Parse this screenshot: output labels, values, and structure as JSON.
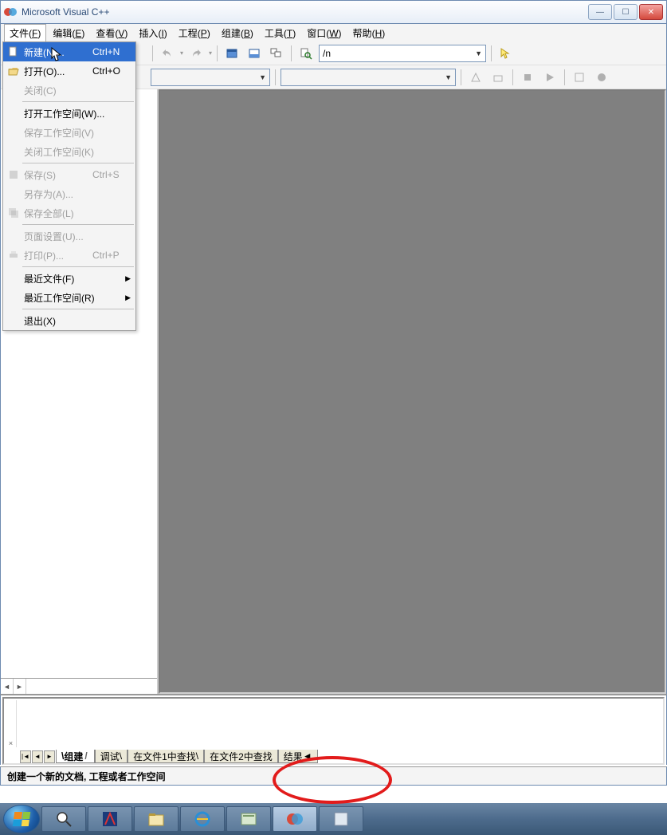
{
  "window": {
    "title": "Microsoft Visual C++"
  },
  "menubar": {
    "items": [
      {
        "label": "文件",
        "key": "F"
      },
      {
        "label": "编辑",
        "key": "E"
      },
      {
        "label": "查看",
        "key": "V"
      },
      {
        "label": "插入",
        "key": "I"
      },
      {
        "label": "工程",
        "key": "P"
      },
      {
        "label": "组建",
        "key": "B"
      },
      {
        "label": "工具",
        "key": "T"
      },
      {
        "label": "窗口",
        "key": "W"
      },
      {
        "label": "帮助",
        "key": "H"
      }
    ]
  },
  "file_menu": {
    "new": {
      "label": "新建(N)...",
      "shortcut": "Ctrl+N"
    },
    "open": {
      "label": "打开(O)...",
      "shortcut": "Ctrl+O"
    },
    "close": {
      "label": "关闭(C)"
    },
    "open_ws": {
      "label": "打开工作空间(W)..."
    },
    "save_ws": {
      "label": "保存工作空间(V)"
    },
    "close_ws": {
      "label": "关闭工作空间(K)"
    },
    "save": {
      "label": "保存(S)",
      "shortcut": "Ctrl+S"
    },
    "save_as": {
      "label": "另存为(A)..."
    },
    "save_all": {
      "label": "保存全部(L)"
    },
    "page_setup": {
      "label": "页面设置(U)..."
    },
    "print": {
      "label": "打印(P)...",
      "shortcut": "Ctrl+P"
    },
    "recent_files": {
      "label": "最近文件(F)"
    },
    "recent_ws": {
      "label": "最近工作空间(R)"
    },
    "exit": {
      "label": "退出(X)"
    }
  },
  "toolbar": {
    "find_value": "/n"
  },
  "output": {
    "tabs": [
      "组建",
      "调试",
      "在文件1中查找",
      "在文件2中查找",
      "结果"
    ]
  },
  "status": {
    "text": "创建一个新的文档, 工程或者工作空间"
  }
}
